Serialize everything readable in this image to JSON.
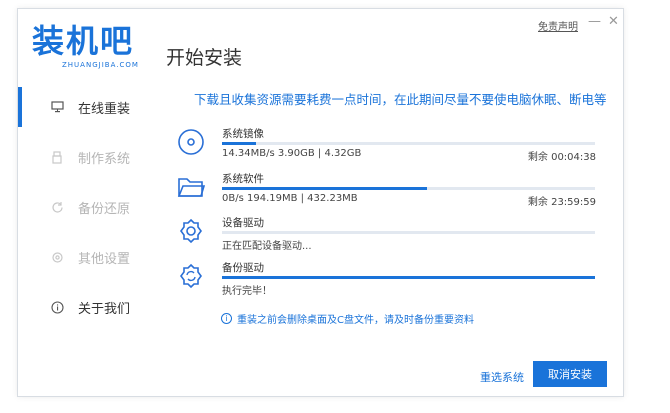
{
  "brand": {
    "logo_text": "装机吧",
    "logo_sub": "ZHUANGJIBA.COM"
  },
  "header": {
    "title": "开始安装",
    "disclaimer": "免责声明",
    "minimize": "—",
    "close": "✕"
  },
  "sidebar": {
    "items": [
      {
        "label": "在线重装",
        "icon": "monitor-icon",
        "active": true
      },
      {
        "label": "制作系统",
        "icon": "usb-icon"
      },
      {
        "label": "备份还原",
        "icon": "backup-icon"
      },
      {
        "label": "其他设置",
        "icon": "settings-icon"
      },
      {
        "label": "关于我们",
        "icon": "info-icon"
      }
    ]
  },
  "main": {
    "notice": "下载且收集资源需要耗费一点时间，在此期间尽量不要使电脑休眠、断电等",
    "tasks": [
      {
        "name": "系统镜像",
        "status": "14.34MB/s 3.90GB | 4.32GB",
        "remaining": "剩余 00:04:38",
        "progress": 0.09,
        "icon": "disc-icon"
      },
      {
        "name": "系统软件",
        "status": "0B/s 194.19MB | 432.23MB",
        "remaining": "剩余 23:59:59",
        "progress": 0.55,
        "icon": "folder-icon"
      },
      {
        "name": "设备驱动",
        "status": "正在匹配设备驱动...",
        "remaining": "",
        "progress": 0.0,
        "icon": "gear-icon"
      },
      {
        "name": "备份驱动",
        "status": "执行完毕！",
        "remaining": "",
        "progress": 1.0,
        "icon": "gear-refresh-icon"
      }
    ],
    "warning": "重装之前会删除桌面及C盘文件，请及时备份重要资料",
    "warning_icon": "i"
  },
  "footer": {
    "reselect_label": "重选系统",
    "cancel_label": "取消安装"
  },
  "colors": {
    "accent": "#1a73d9",
    "track": "#e2e8f0"
  }
}
